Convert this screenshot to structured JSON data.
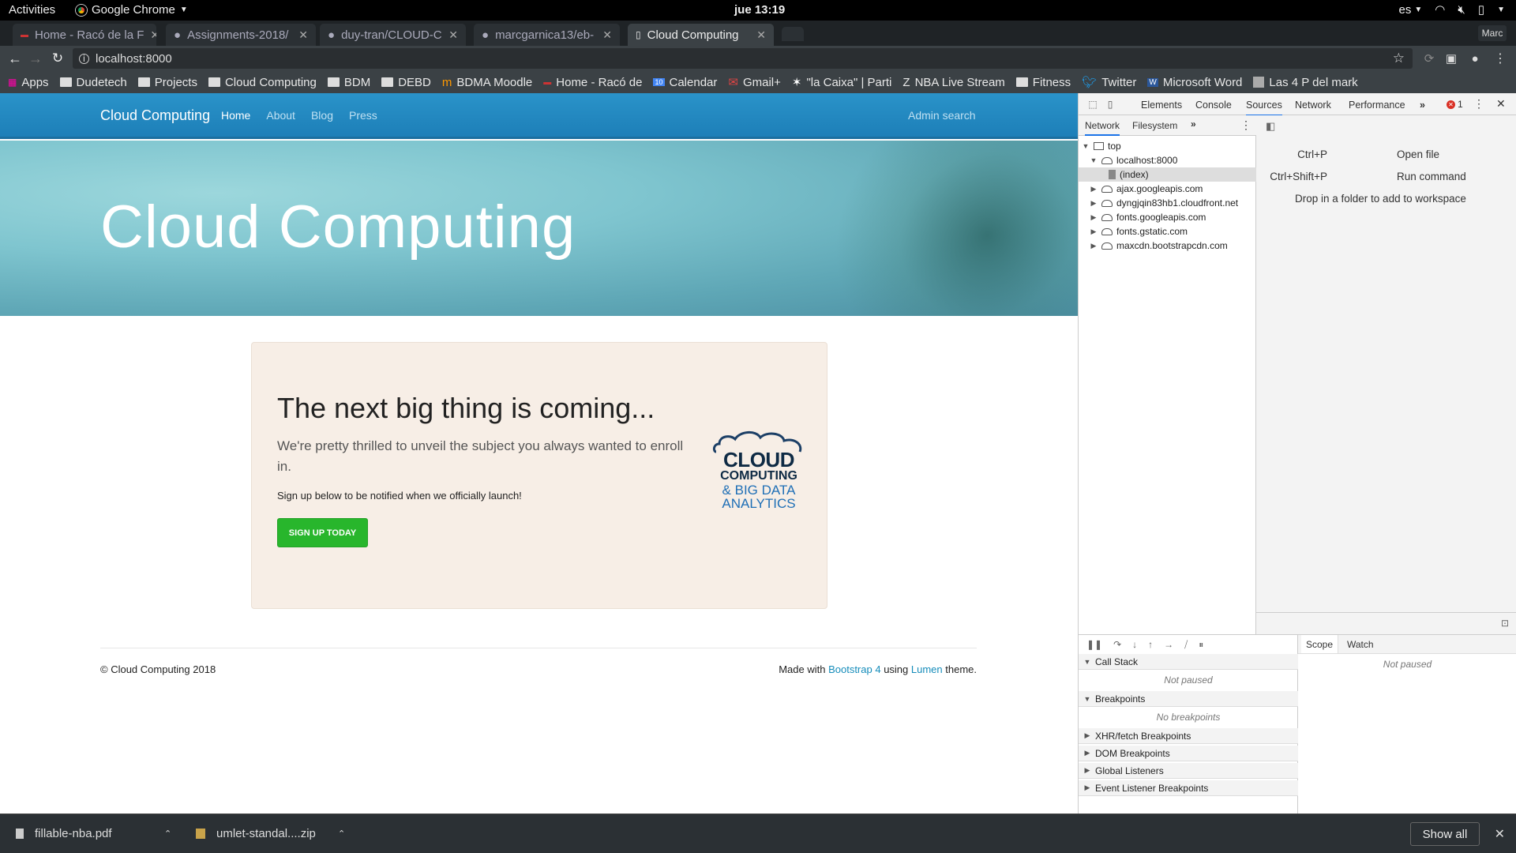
{
  "topbar": {
    "activities": "Activities",
    "app": "Google Chrome",
    "clock": "jue 13:19",
    "lang": "es"
  },
  "browser": {
    "tabs": [
      {
        "label": "Home - Racó de la F"
      },
      {
        "label": "Assignments-2018/"
      },
      {
        "label": "duy-tran/CLOUD-C"
      },
      {
        "label": "marcgarnica13/eb-"
      },
      {
        "label": "Cloud Computing"
      }
    ],
    "profile": "Marc",
    "url": "localhost:8000",
    "bookmarks": [
      "Apps",
      "Dudetech",
      "Projects",
      "Cloud Computing",
      "BDM",
      "DEBD",
      "BDMA Moodle",
      "Home - Racó de",
      "Calendar",
      "Gmail+",
      "\"la Caixa\" | Parti",
      "NBA Live Stream",
      "Fitness",
      "Twitter",
      "Microsoft Word",
      "Las 4 P del mark"
    ]
  },
  "site": {
    "brand": "Cloud Computing",
    "nav": [
      "Home",
      "About",
      "Blog",
      "Press"
    ],
    "admin": "Admin search",
    "hero_title": "Cloud Computing",
    "card": {
      "heading": "The next big thing is coming...",
      "lead": "We're pretty thrilled to unveil the subject you always wanted to enroll in.",
      "small": "Sign up below to be notified when we officially launch!",
      "button": "SIGN UP TODAY",
      "logo": {
        "line1": "CLOUD",
        "line2": "COMPUTING",
        "line3": "& BIG DATA",
        "line4": "ANALYTICS"
      }
    },
    "footer": {
      "copy": "© Cloud Computing 2018",
      "made_pre": "Made with ",
      "bootstrap": "Bootstrap 4",
      "using": " using ",
      "lumen": "Lumen",
      "theme": " theme."
    }
  },
  "devtools": {
    "tabs": [
      "Elements",
      "Console",
      "Sources",
      "Network",
      "Performance"
    ],
    "errors": "1",
    "subtabs": [
      "Network",
      "Filesystem"
    ],
    "tree": [
      "top",
      "localhost:8000",
      "(index)",
      "ajax.googleapis.com",
      "dyngjqin83hb1.cloudfront.net",
      "fonts.googleapis.com",
      "fonts.gstatic.com",
      "maxcdn.bootstrapcdn.com"
    ],
    "shortcuts": [
      {
        "key": "Ctrl+P",
        "action": "Open file"
      },
      {
        "key": "Ctrl+Shift+P",
        "action": "Run command"
      }
    ],
    "drop": "Drop in a folder to add to workspace",
    "sections": [
      "Call Stack",
      "Breakpoints",
      "XHR/fetch Breakpoints",
      "DOM Breakpoints",
      "Global Listeners",
      "Event Listener Breakpoints"
    ],
    "not_paused": "Not paused",
    "no_breakpoints": "No breakpoints",
    "scope": "Scope",
    "watch": "Watch"
  },
  "downloads": {
    "items": [
      "fillable-nba.pdf",
      "umlet-standal....zip"
    ],
    "show_all": "Show all"
  }
}
